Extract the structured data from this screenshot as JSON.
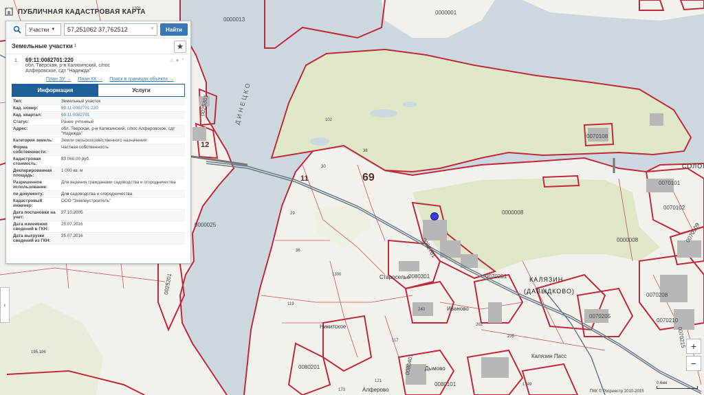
{
  "app": {
    "title": "ПУБЛИЧНАЯ КАДАСТРОВАЯ КАРТА"
  },
  "search": {
    "type_label": "Участки",
    "query": "57,251062 37,762512",
    "button_label": "Найти"
  },
  "section": {
    "title": "Земельные участки",
    "count": "1"
  },
  "result": {
    "index": "1.",
    "cad_number": "69:11:0082701:220",
    "address_line1": "обл. Тверская, р-н Калязинский, с/пос",
    "address_line2": "Алферовское, сдт \"Надежда\"",
    "links": [
      "План ЗУ →",
      "План КК →",
      "Поиск в границах объекта →"
    ]
  },
  "tabs": [
    {
      "label": "Информация"
    },
    {
      "label": "Услуги"
    }
  ],
  "props": [
    {
      "k": "Тип:",
      "v": "Земельный участок"
    },
    {
      "k": "Кад. номер:",
      "v": "69:11:0082701:220"
    },
    {
      "k": "Кад. квартал:",
      "v": "69:11:0082701"
    },
    {
      "k": "Статус:",
      "v": "Ранее учтенный"
    },
    {
      "k": "Адрес:",
      "v": "обл. Тверская, р-н Калязинский, с/пос Алферовское, сдт \"Надежда\""
    },
    {
      "k": "Категория земель:",
      "v": "Земли сельскохозяйственного назначения"
    },
    {
      "k": "Форма собственности:",
      "v": "Частная собственность"
    },
    {
      "k": "Кадастровая стоимость:",
      "v": "83 060,00 руб."
    },
    {
      "k": "Декларированная площадь:",
      "v": "1 000 кв. м"
    },
    {
      "k": "Разрешенное использование:",
      "v": "Для ведения гражданами садоводства и огородничества"
    },
    {
      "k": "по документу:",
      "v": "Для садоводства и огородничества"
    },
    {
      "k": "Кадастровый инженер:",
      "v": "ООО \"Землеустроитель\""
    },
    {
      "k": "Дата постановки на учет:",
      "v": "27.10.2005"
    },
    {
      "k": "Дата изменения сведений в ГКН:",
      "v": "25.07.2016"
    },
    {
      "k": "Дата выгрузки сведений из ГКН:",
      "v": "25.07.2016"
    }
  ],
  "map_labels": {
    "big_69": "69",
    "big_11": "11",
    "big_12": "12",
    "kalyazin": "КАЛЯЗИН",
    "davydkovo": "(ДАВЫДКОВО)",
    "solono": "СОЛОНО",
    "staroe": "Староселье",
    "nikitskoe": "Никитское",
    "ivanovo": "Иваново",
    "dymovo": "Дымово",
    "alferovo": "Алферово",
    "kalyazin_pass": "Калязин Пасс",
    "river_vertical": "ДИНЕЦКО",
    "parcels": [
      "0000001",
      "0000013",
      "0000025",
      "0000008",
      "0000008",
      "0070108",
      "0070101",
      "0070102",
      "0082701",
      "0080301",
      "0070201",
      "0070205",
      "0070208",
      "0070210",
      "0070215",
      "0080201",
      "0080401",
      "0080101",
      "0025201",
      "0025301",
      "0070109"
    ],
    "numbers": [
      "102",
      "38",
      "30",
      "29",
      "36",
      "1300",
      "119",
      "117",
      "240",
      "262",
      "235",
      "121",
      "1749",
      "173",
      "195.196",
      "1301"
    ]
  },
  "zoom": {
    "plus": "+",
    "minus": "−"
  },
  "scale": {
    "label": "0.6км"
  },
  "copyright": "ПКК © Росреестр 2010-2015",
  "left_arrow": "‹",
  "colors": {
    "parcel_border": "#c0283b",
    "water": "#ccd8de",
    "land": "#f4f2ee",
    "green": "#dfe8c6",
    "accent": "#1f5f99"
  }
}
